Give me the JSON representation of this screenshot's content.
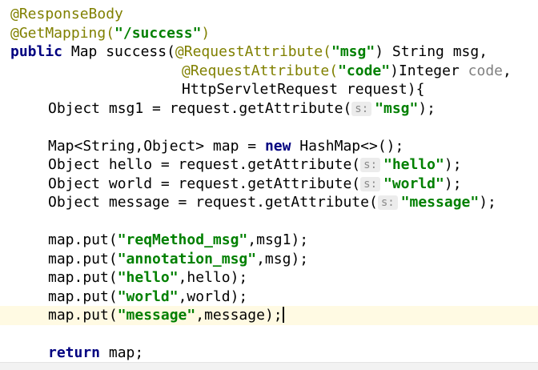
{
  "colors": {
    "annotation": "#808000",
    "keyword": "#000080",
    "string": "#008000",
    "unused_param": "#808080",
    "current_line_bg": "#fffae3",
    "hint_bg": "#ececec"
  },
  "hint_label": "s:",
  "code": {
    "l1": {
      "ann": "@ResponseBody"
    },
    "l2": {
      "ann": "@GetMapping(",
      "str": "\"/success\"",
      "tail": ")"
    },
    "l3": {
      "kw": "public",
      "a": " Map success(",
      "ann": "@RequestAttribute(",
      "str": "\"msg\"",
      "b": ") String msg,"
    },
    "l4": {
      "ann": "@RequestAttribute(",
      "str": "\"code\"",
      "a": ")Integer ",
      "unused": "code",
      "b": ","
    },
    "l5": {
      "a": "HttpServletRequest request){"
    },
    "l6": {
      "a": "Object msg1 = request.getAttribute(",
      "str": "\"msg\"",
      "b": ");"
    },
    "l8": {
      "a": "Map<String,Object> map = ",
      "kw": "new",
      "b": " HashMap<>();"
    },
    "l9": {
      "a": "Object hello = request.getAttribute(",
      "str": "\"hello\"",
      "b": ");"
    },
    "l10": {
      "a": "Object world = request.getAttribute(",
      "str": "\"world\"",
      "b": ");"
    },
    "l11": {
      "a": "Object message = request.getAttribute(",
      "str": "\"message\"",
      "b": ");"
    },
    "l13": {
      "a": "map.put(",
      "str": "\"reqMethod_msg\"",
      "b": ",msg1);"
    },
    "l14": {
      "a": "map.put(",
      "str": "\"annotation_msg\"",
      "b": ",msg);"
    },
    "l15": {
      "a": "map.put(",
      "str": "\"hello\"",
      "b": ",hello);"
    },
    "l16": {
      "a": "map.put(",
      "str": "\"world\"",
      "b": ",world);"
    },
    "l17": {
      "a": "map.put(",
      "str": "\"message\"",
      "b": ",message);"
    },
    "l19": {
      "kw": "return",
      "b": " map;"
    }
  }
}
